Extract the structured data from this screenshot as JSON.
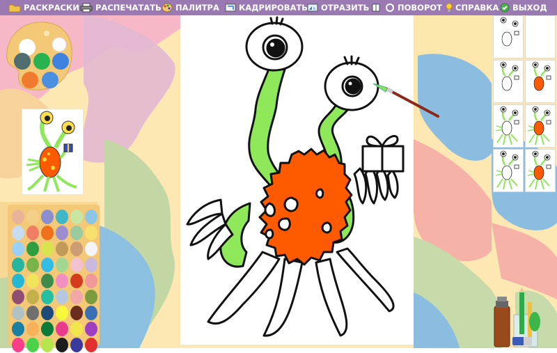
{
  "menu": {
    "items": [
      {
        "label": "РАСКРАСКИ",
        "icon": "folder-icon"
      },
      {
        "label": "РАСПЕЧАТАТЬ",
        "icon": "printer-icon"
      },
      {
        "label": "ПАЛИТРА",
        "icon": "palette-icon"
      },
      {
        "label": "КАДРИРОВАТЬ",
        "icon": "crop-icon"
      },
      {
        "label": "ОТРАЗИТЬ",
        "icon": "mirror-icon"
      },
      {
        "label": "ПОВОРОТ",
        "icon": "rotate-icon"
      },
      {
        "label": "СПРАВКА",
        "icon": "lightbulb-icon"
      },
      {
        "label": "ВЫХОД",
        "icon": "exit-icon"
      }
    ]
  },
  "colors": {
    "menubar": "#9b79b3",
    "monster_green": "#8ee85a",
    "monster_orange": "#ff5a00",
    "palette_board": "#f3c978"
  },
  "palette_board": {
    "colors": [
      "#ffffff",
      "#28b24f",
      "#3f82e0",
      "#f07a2e",
      "#6c5a48",
      "#4a90e2"
    ]
  },
  "swatches": [
    "#e9b39a",
    "#f5ce88",
    "#8b8fcf",
    "#3fb7c6",
    "#c6e6a2",
    "#8bc6e6",
    "#c8dcef",
    "#ef7e62",
    "#ef6f1b",
    "#9a8fcf",
    "#9acb9f",
    "#f7e06d",
    "#9ad1f4",
    "#2e9e3e",
    "#d8e44d",
    "#c09a58",
    "#cc9c72",
    "#f4f4f4",
    "#27b5a0",
    "#79b44a",
    "#31bde6",
    "#a1d693",
    "#f2c2d0",
    "#c9b9de",
    "#26b8d2",
    "#f2e45a",
    "#3e8b4b",
    "#f18ec3",
    "#d33d1d",
    "#f19898",
    "#8f4e72",
    "#c3b04a",
    "#25c0a2",
    "#b6c8df",
    "#f1a8a7",
    "#7b9b3e",
    "#b0c2c4",
    "#6f6f6f",
    "#1e4a7a",
    "#f8f83a",
    "#6c2d1e",
    "#3b6fb3",
    "#1a7fa4",
    "#f5b25a",
    "#0b7a3a",
    "#e83b8e",
    "#f3e54e",
    "#9e3ec0",
    "#fa3e8b",
    "#4ad24a",
    "#b5e64d",
    "#1d1d1d",
    "#3a3a9e",
    "#e02f2f"
  ],
  "thumbnails": [
    {
      "style": "line"
    },
    {
      "style": "blank"
    },
    {
      "style": "partial"
    },
    {
      "style": "partial-orange"
    },
    {
      "style": "green"
    },
    {
      "style": "green-orange"
    },
    {
      "style": "green"
    },
    {
      "style": "green-orange"
    }
  ]
}
